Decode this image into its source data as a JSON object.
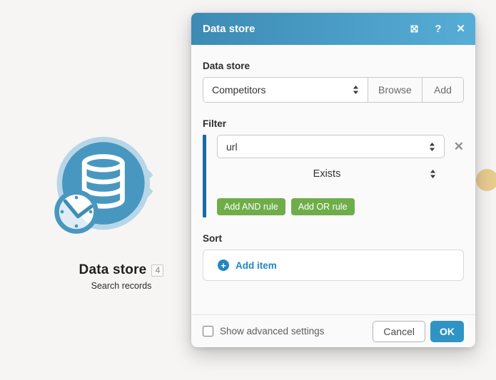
{
  "canvas": {
    "module": {
      "label": "Data store",
      "badge": "4",
      "sublabel": "Search records",
      "circle_color": "#4897c0",
      "halo_color": "#b7d6e7",
      "icons": [
        "database-icon",
        "clock-icon"
      ]
    },
    "connector_dot_color": "#e8cc8f"
  },
  "modal": {
    "title": "Data store",
    "header": {
      "help_icon": "?",
      "close_icon": "✕",
      "gradient_left": "#3d8bb4",
      "gradient_right": "#56add6"
    },
    "datastore_field": {
      "label": "Data store",
      "selected": "Competitors",
      "browse_label": "Browse",
      "add_label": "Add"
    },
    "filter": {
      "label": "Filter",
      "field_selected": "url",
      "remove_icon": "✕",
      "operator_selected": "Exists",
      "add_and_label": "Add AND rule",
      "add_or_label": "Add OR rule",
      "accent_color": "#1b6ba5",
      "rule_button_color": "#6fad4a"
    },
    "sort": {
      "label": "Sort",
      "add_item_plus": "+",
      "add_item_label": "Add item",
      "link_color": "#1f87c2"
    },
    "footer": {
      "checkbox_label": "Show advanced settings",
      "checkbox_checked": false,
      "cancel_label": "Cancel",
      "ok_label": "OK",
      "ok_color": "#3093c5"
    }
  }
}
